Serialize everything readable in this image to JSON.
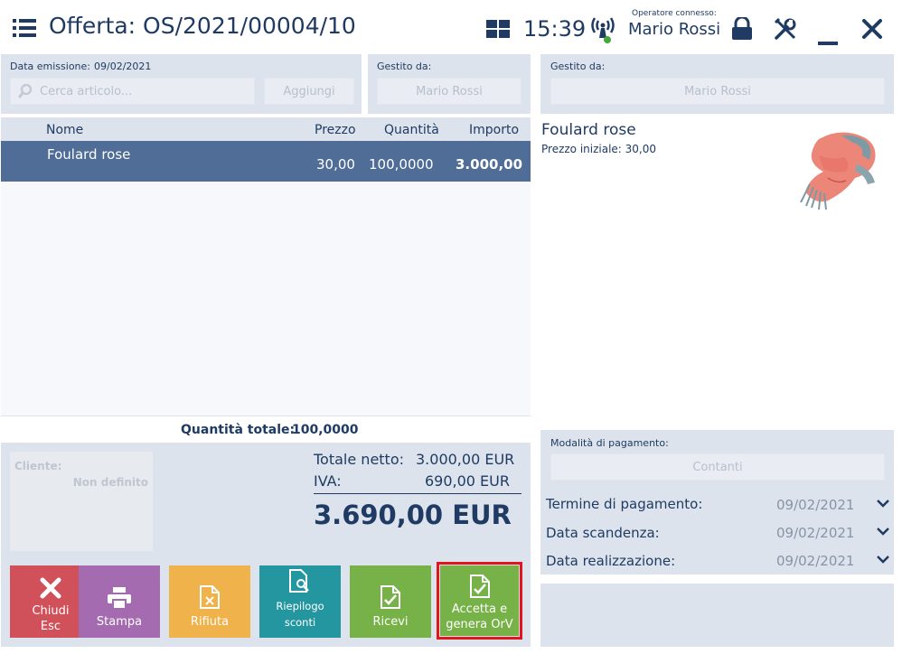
{
  "header": {
    "title": "Offerta: OS/2021/00004/10",
    "time": "15:39",
    "operator_label": "Operatore connesso:",
    "operator_name": "Mario Rossi"
  },
  "document": {
    "issue_date_label": "Data emissione:",
    "issue_date": "09/02/2021",
    "search_placeholder": "Cerca articolo...",
    "add_label": "Aggiungi",
    "managed_by_label": "Gestito da:",
    "managed_by": "Mario Rossi"
  },
  "right_panel": {
    "managed_by_label": "Gestito da:",
    "managed_by": "Mario Rossi",
    "product_name": "Foulard rose",
    "initial_price": "Prezzo iniziale: 30,00"
  },
  "table": {
    "columns": [
      "Nome",
      "Prezzo",
      "Quantità",
      "Importo"
    ],
    "rows": [
      {
        "name": "Foulard rose",
        "price": "30,00",
        "qty": "100,0000",
        "amount": "3.000,00"
      }
    ],
    "total_qty_label": "Quantità totale:",
    "total_qty": "100,0000"
  },
  "summary": {
    "client_label": "Cliente:",
    "client_value": "Non definito",
    "net_label": "Totale netto:",
    "net_value": "3.000,00 EUR",
    "vat_label": "IVA:",
    "vat_value": "690,00 EUR",
    "total": "3.690,00 EUR"
  },
  "payment": {
    "method_label": "Modalità di pagamento:",
    "method": "Contanti",
    "due_term_label": "Termine di pagamento:",
    "due_term": "09/02/2021",
    "expiry_label": "Data scandenza:",
    "expiry": "09/02/2021",
    "realization_label": "Data realizzazione:",
    "realization": "09/02/2021"
  },
  "buttons": {
    "close_line1": "Chiudi",
    "close_line2": "Esc",
    "print": "Stampa",
    "reject": "Rifiuta",
    "discounts": "Riepilogo sconti",
    "receive": "Ricevi",
    "accept_line1": "Accetta e",
    "accept_line2": "genera OrV"
  },
  "colors": {
    "header_text": "#1f3b63",
    "panel_bg": "#dde3ec",
    "selected_row": "#4f6d96",
    "close_btn": "#d0515a",
    "print_btn": "#a46bb0",
    "reject_btn": "#f0b24a",
    "discounts_btn": "#24969f",
    "receive_btn": "#76b247",
    "accept_btn": "#76b247",
    "highlight_border": "#e2141c"
  }
}
